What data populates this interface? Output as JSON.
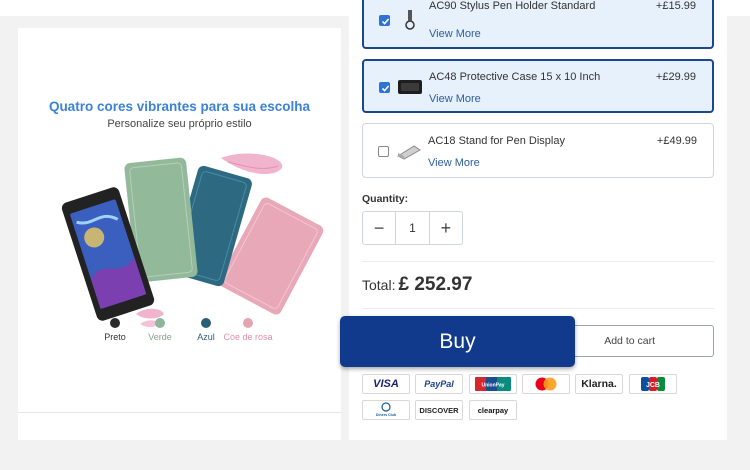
{
  "promo": {
    "headline": "Quatro cores vibrantes para sua escolha",
    "subtitle": "Personalize seu próprio estilo",
    "colors": [
      {
        "label": "Preto",
        "hex": "#2b2b2b",
        "label_color": "#333333"
      },
      {
        "label": "Verde",
        "hex": "#8fb59a",
        "label_color": "#8a9f90"
      },
      {
        "label": "Azul",
        "hex": "#2b5e78",
        "label_color": "#2b5e78"
      },
      {
        "label": "Coe de rosa",
        "hex": "#e3a3b3",
        "label_color": "#e58fa6"
      }
    ]
  },
  "accessories": [
    {
      "name": "AC90 Stylus Pen Holder Standard",
      "price": "+£15.99",
      "more": "View More",
      "checked": true,
      "icon": "pen-holder-icon"
    },
    {
      "name": "AC48 Protective Case 15 x 10 Inch",
      "price": "+£29.99",
      "more": "View More",
      "checked": true,
      "icon": "protective-case-icon"
    },
    {
      "name": "AC18 Stand for Pen Display",
      "price": "+£49.99",
      "more": "View More",
      "checked": false,
      "icon": "stand-icon"
    }
  ],
  "quantity": {
    "label": "Quantity:",
    "value": "1",
    "minus": "−",
    "plus": "+"
  },
  "total": {
    "label": "Total:",
    "amount": "£ 252.97"
  },
  "actions": {
    "buy": "Buy",
    "add_to_cart": "Add to cart"
  },
  "payments": [
    "VISA",
    "PayPal",
    "UnionPay",
    "Mastercard",
    "Klarna.",
    "JCB",
    "Diners Club",
    "DISCOVER",
    "clearpay"
  ],
  "colors": {
    "primary": "#113a8c",
    "accent_blue": "#3b82d6",
    "selected_bg": "#e6f1fb",
    "link": "#2e5d9f"
  }
}
